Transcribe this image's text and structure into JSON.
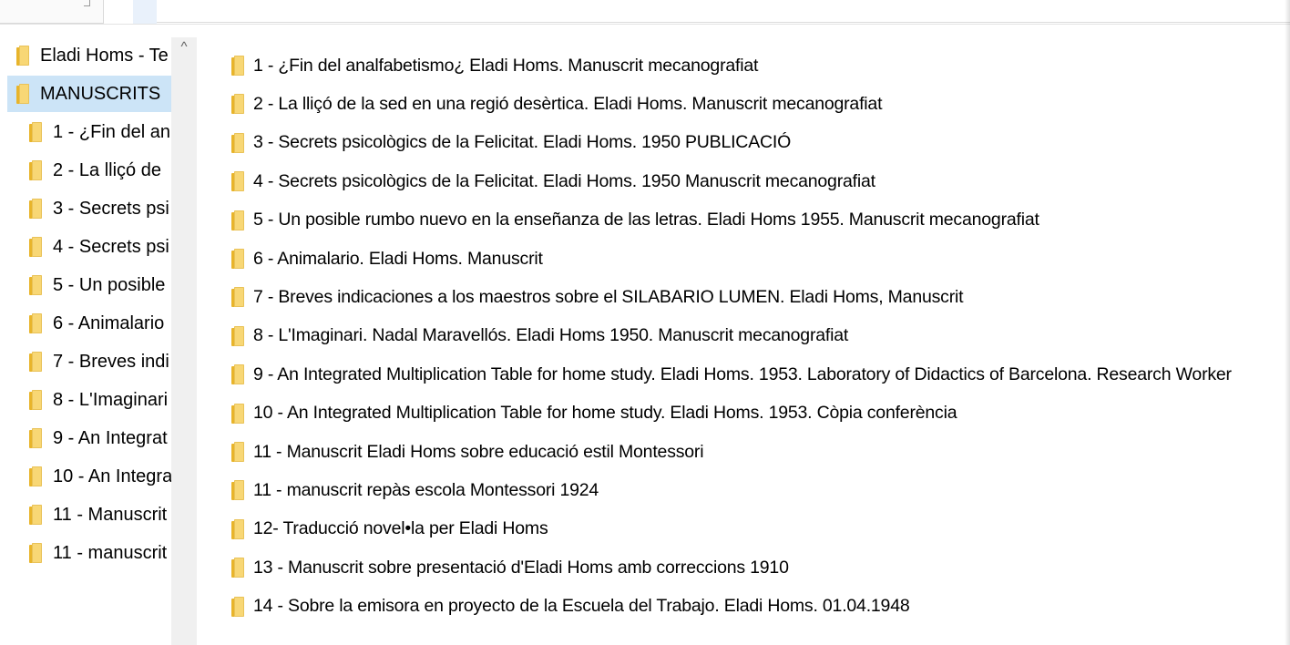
{
  "nav": {
    "items": [
      {
        "label": "Eladi Homs - Te",
        "level": 1,
        "selected": false
      },
      {
        "label": "MANUSCRITS",
        "level": 1,
        "selected": true
      },
      {
        "label": "1 - ¿Fin del an",
        "level": 2,
        "selected": false
      },
      {
        "label": "2 - La lliçó de",
        "level": 2,
        "selected": false
      },
      {
        "label": "3 - Secrets psi",
        "level": 2,
        "selected": false
      },
      {
        "label": "4 - Secrets psi",
        "level": 2,
        "selected": false
      },
      {
        "label": "5 - Un posible",
        "level": 2,
        "selected": false
      },
      {
        "label": "6 - Animalario",
        "level": 2,
        "selected": false
      },
      {
        "label": "7 - Breves indi",
        "level": 2,
        "selected": false
      },
      {
        "label": "8 - L'Imaginari",
        "level": 2,
        "selected": false
      },
      {
        "label": "9 - An Integrat",
        "level": 2,
        "selected": false
      },
      {
        "label": "10 - An Integra",
        "level": 2,
        "selected": false
      },
      {
        "label": "11 - Manuscrit",
        "level": 2,
        "selected": false
      },
      {
        "label": "11 - manuscrit",
        "level": 2,
        "selected": false
      }
    ],
    "scroll_up_glyph": "^"
  },
  "files": [
    "1 - ¿Fin del analfabetismo¿ Eladi Homs. Manuscrit mecanografiat",
    "2 - La lliçó de la sed en una regió desèrtica. Eladi Homs. Manuscrit mecanografiat",
    "3 - Secrets psicològics de la Felicitat. Eladi Homs. 1950 PUBLICACIÓ",
    "4 - Secrets psicològics de la Felicitat. Eladi Homs. 1950 Manuscrit mecanografiat",
    "5 - Un posible rumbo nuevo en la enseñanza de las letras. Eladi Homs 1955. Manuscrit mecanografiat",
    "6 - Animalario. Eladi Homs. Manuscrit",
    "7 - Breves indicaciones a los maestros sobre el SILABARIO LUMEN. Eladi Homs, Manuscrit",
    "8 - L'Imaginari. Nadal Maravellós. Eladi Homs 1950. Manuscrit mecanografiat",
    "9 - An Integrated Multiplication Table for home study. Eladi Homs. 1953. Laboratory of Didactics of Barcelona. Research Worker",
    "10 - An Integrated Multiplication Table for home study. Eladi Homs. 1953. Còpia conferència",
    "11 - Manuscrit Eladi Homs sobre educació estil Montessori",
    "11 - manuscrit repàs escola Montessori 1924",
    "12- Traducció novel•la  per Eladi Homs",
    "13 - Manuscrit sobre presentació d'Eladi Homs amb correccions 1910",
    "14 - Sobre la emisora en proyecto de la Escuela del Trabajo. Eladi Homs. 01.04.1948"
  ],
  "icons": {
    "folder": "folder-icon"
  },
  "colors": {
    "selection": "#cce4f7",
    "folder": "#f8d775",
    "folder_dark": "#e8b42a"
  }
}
